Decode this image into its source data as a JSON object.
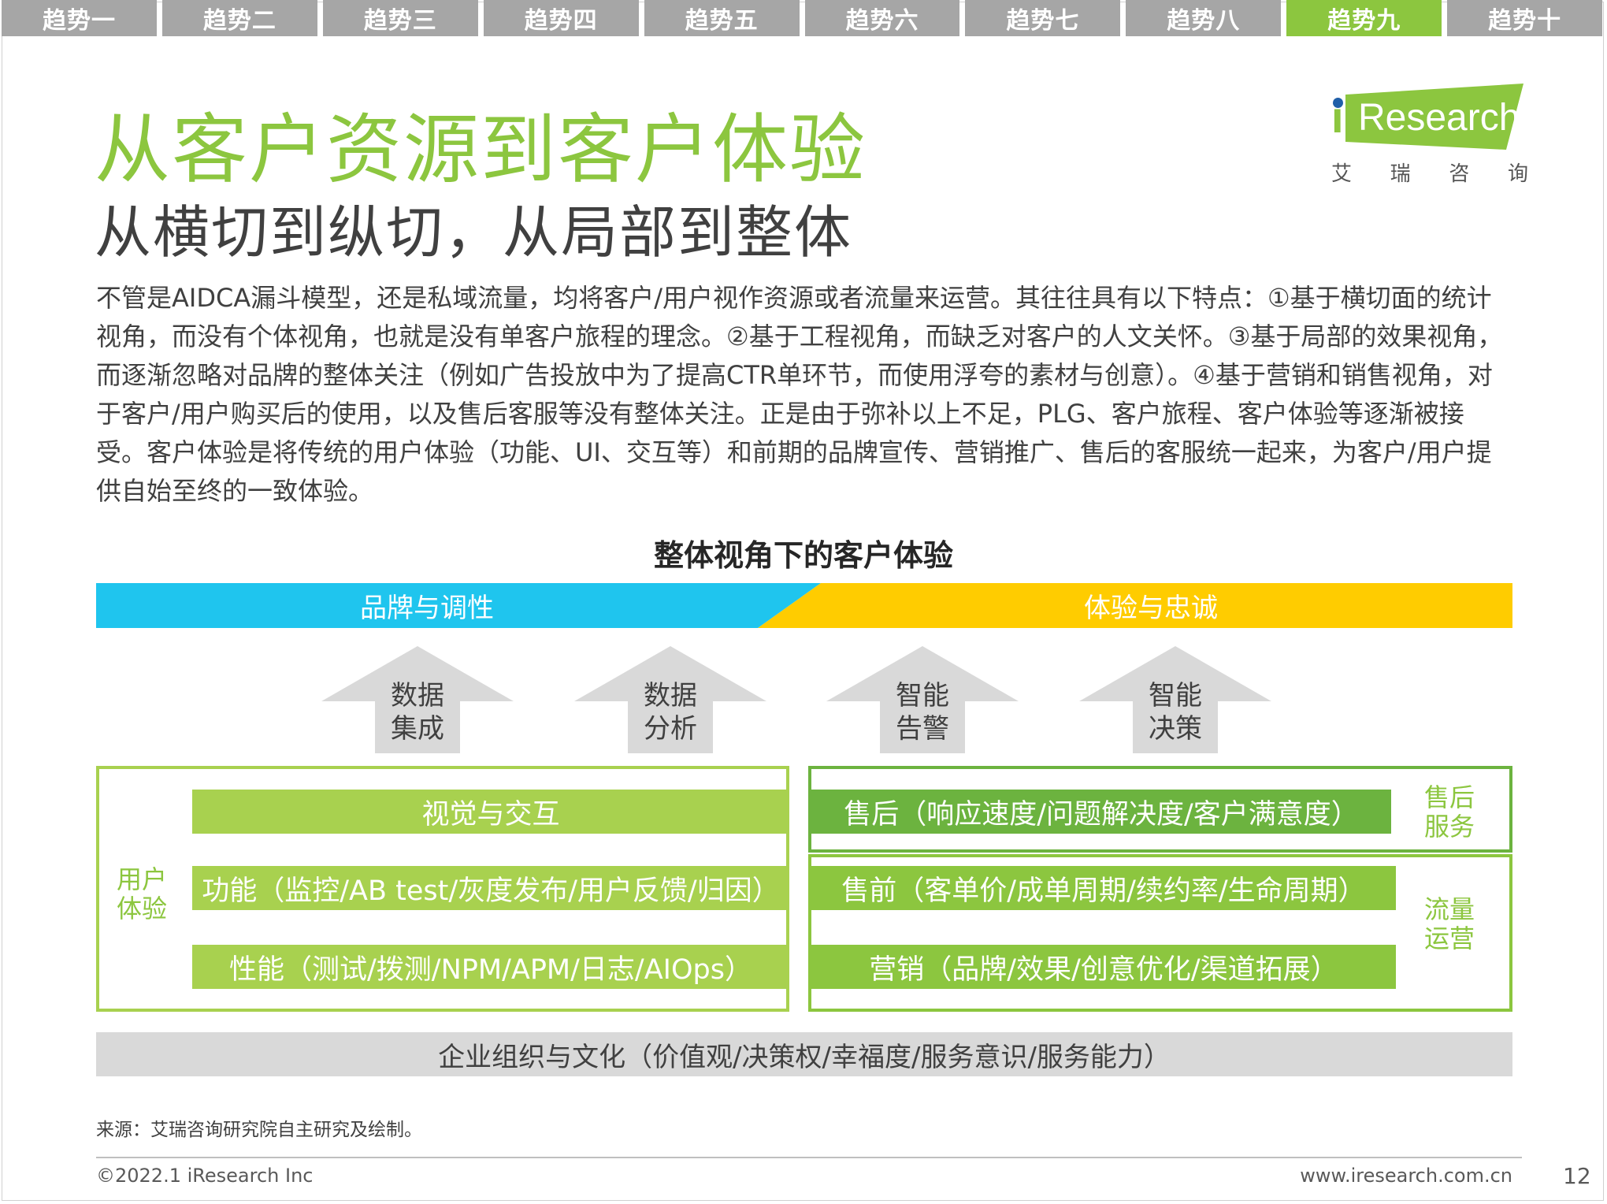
{
  "tabs": [
    {
      "label": "趋势一"
    },
    {
      "label": "趋势二"
    },
    {
      "label": "趋势三"
    },
    {
      "label": "趋势四"
    },
    {
      "label": "趋势五"
    },
    {
      "label": "趋势六"
    },
    {
      "label": "趋势七"
    },
    {
      "label": "趋势八"
    },
    {
      "label": "趋势九"
    },
    {
      "label": "趋势十"
    }
  ],
  "active_tab": "趋势九",
  "logo": {
    "wordmark": "Research",
    "i_letter": "i",
    "cn": [
      "艾",
      "瑞",
      "咨",
      "询"
    ]
  },
  "title": "从客户资源到客户体验",
  "subtitle": "从横切到纵切，从局部到整体",
  "body": "不管是AIDCA漏斗模型，还是私域流量，均将客户/用户视作资源或者流量来运营。其往往具有以下特点：①基于横切面的统计视角，而没有个体视角，也就是没有单客户旅程的理念。②基于工程视角，而缺乏对客户的人文关怀。③基于局部的效果视角，而逐渐忽略对品牌的整体关注（例如广告投放中为了提高CTR单环节，而使用浮夸的素材与创意）。④基于营销和销售视角，对于客户/用户购买后的使用，以及售后客服等没有整体关注。正是由于弥补以上不足，PLG、客户旅程、客户体验等逐渐被接受。客户体验是将传统的用户体验（功能、UI、交互等）和前期的品牌宣传、营销推广、售后的客服统一起来，为客户/用户提供自始至终的一致体验。",
  "diagram": {
    "title": "整体视角下的客户体验",
    "banner_left": "品牌与调性",
    "banner_right": "体验与忠诚",
    "arrows": [
      {
        "line1": "数据",
        "line2": "集成"
      },
      {
        "line1": "数据",
        "line2": "分析"
      },
      {
        "line1": "智能",
        "line2": "告警"
      },
      {
        "line1": "智能",
        "line2": "决策"
      }
    ],
    "left_label": [
      "用户",
      "体验"
    ],
    "left_bars": [
      "视觉与交互",
      "功能（监控/AB test/灰度发布/用户反馈/归因）",
      "性能（测试/拨测/NPM/APM/日志/AIOps）"
    ],
    "right_bars": [
      "售后（响应速度/问题解决度/客户满意度）",
      "售前（客单价/成单周期/续约率/生命周期）",
      "营销（品牌/效果/创意优化/渠道拓展）"
    ],
    "right_label_top": [
      "售后",
      "服务"
    ],
    "right_label_bottom": [
      "流量",
      "运营"
    ],
    "foundation": "企业组织与文化（价值观/决策权/幸福度/服务意识/服务能力）"
  },
  "source": "来源：艾瑞咨询研究院自主研究及绘制。",
  "footer": {
    "copyright": "©2022.1 iResearch Inc",
    "url": "www.iresearch.com.cn",
    "page": "12"
  },
  "colors": {
    "tab": "#a6a6a6",
    "tab_active": "#8cc63f",
    "green": "#8cc63f",
    "blue": "#1fc5ee",
    "yellow": "#ffcc00",
    "gray": "#d9d9d9"
  }
}
